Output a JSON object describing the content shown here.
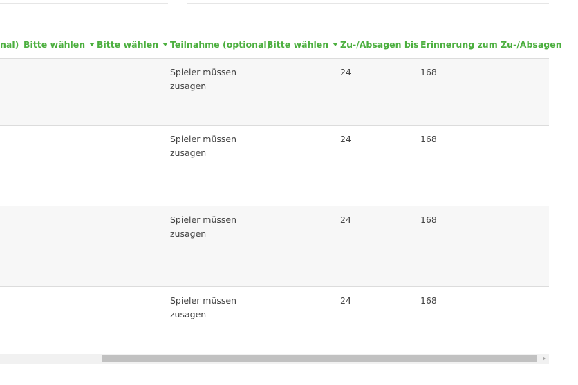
{
  "header": {
    "columns": [
      {
        "label": "nal)",
        "dropdown": false
      },
      {
        "label": "Bitte wählen",
        "dropdown": true
      },
      {
        "label": "Bitte wählen",
        "dropdown": true
      },
      {
        "label": "Teilnahme (optional)",
        "dropdown": false
      },
      {
        "label": "Bitte wählen",
        "dropdown": true
      },
      {
        "label": "Zu-/Absagen bis",
        "dropdown": false
      },
      {
        "label": "Erinnerung zum Zu-/Absagen",
        "dropdown": false
      }
    ]
  },
  "rows": [
    {
      "teilnahme": "Spieler müssen zusagen",
      "bis": "24",
      "erinnerung": "168"
    },
    {
      "teilnahme": "Spieler müssen zusagen",
      "bis": "24",
      "erinnerung": "168"
    },
    {
      "teilnahme": "Spieler müssen zusagen",
      "bis": "24",
      "erinnerung": "168"
    },
    {
      "teilnahme": "Spieler müssen zusagen",
      "bis": "24",
      "erinnerung": "168"
    }
  ],
  "colors": {
    "accent": "#4caf3f",
    "row_alt": "#f7f7f7"
  },
  "icons": {
    "dropdown": "caret-down-icon",
    "scroll_right": "arrow-right-icon"
  }
}
